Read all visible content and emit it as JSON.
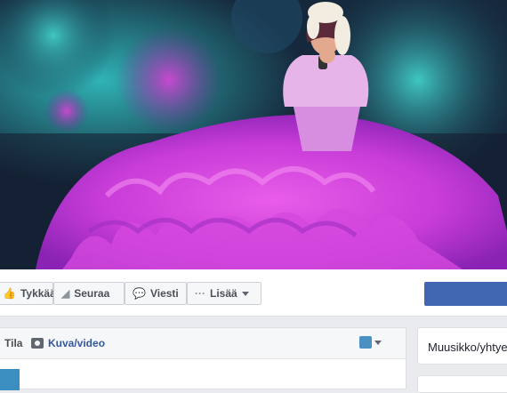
{
  "actions": {
    "like_label": "Tykkää",
    "follow_label": "Seuraa",
    "message_label": "Viesti",
    "more_label": "Lisää"
  },
  "composer": {
    "status_tab": "Tila",
    "photo_video_tab": "Kuva/video"
  },
  "sidebar": {
    "category": "Muusikko/yhtye"
  },
  "icons": {
    "like": "thumbs-up-icon",
    "follow": "rss-icon",
    "message": "chat-bubble-icon",
    "more": "ellipsis-icon",
    "camera": "camera-icon",
    "audience": "audience-selector-icon"
  },
  "colors": {
    "primary_button": "#4267b2",
    "link": "#365899",
    "page_background": "#e9ebee"
  }
}
